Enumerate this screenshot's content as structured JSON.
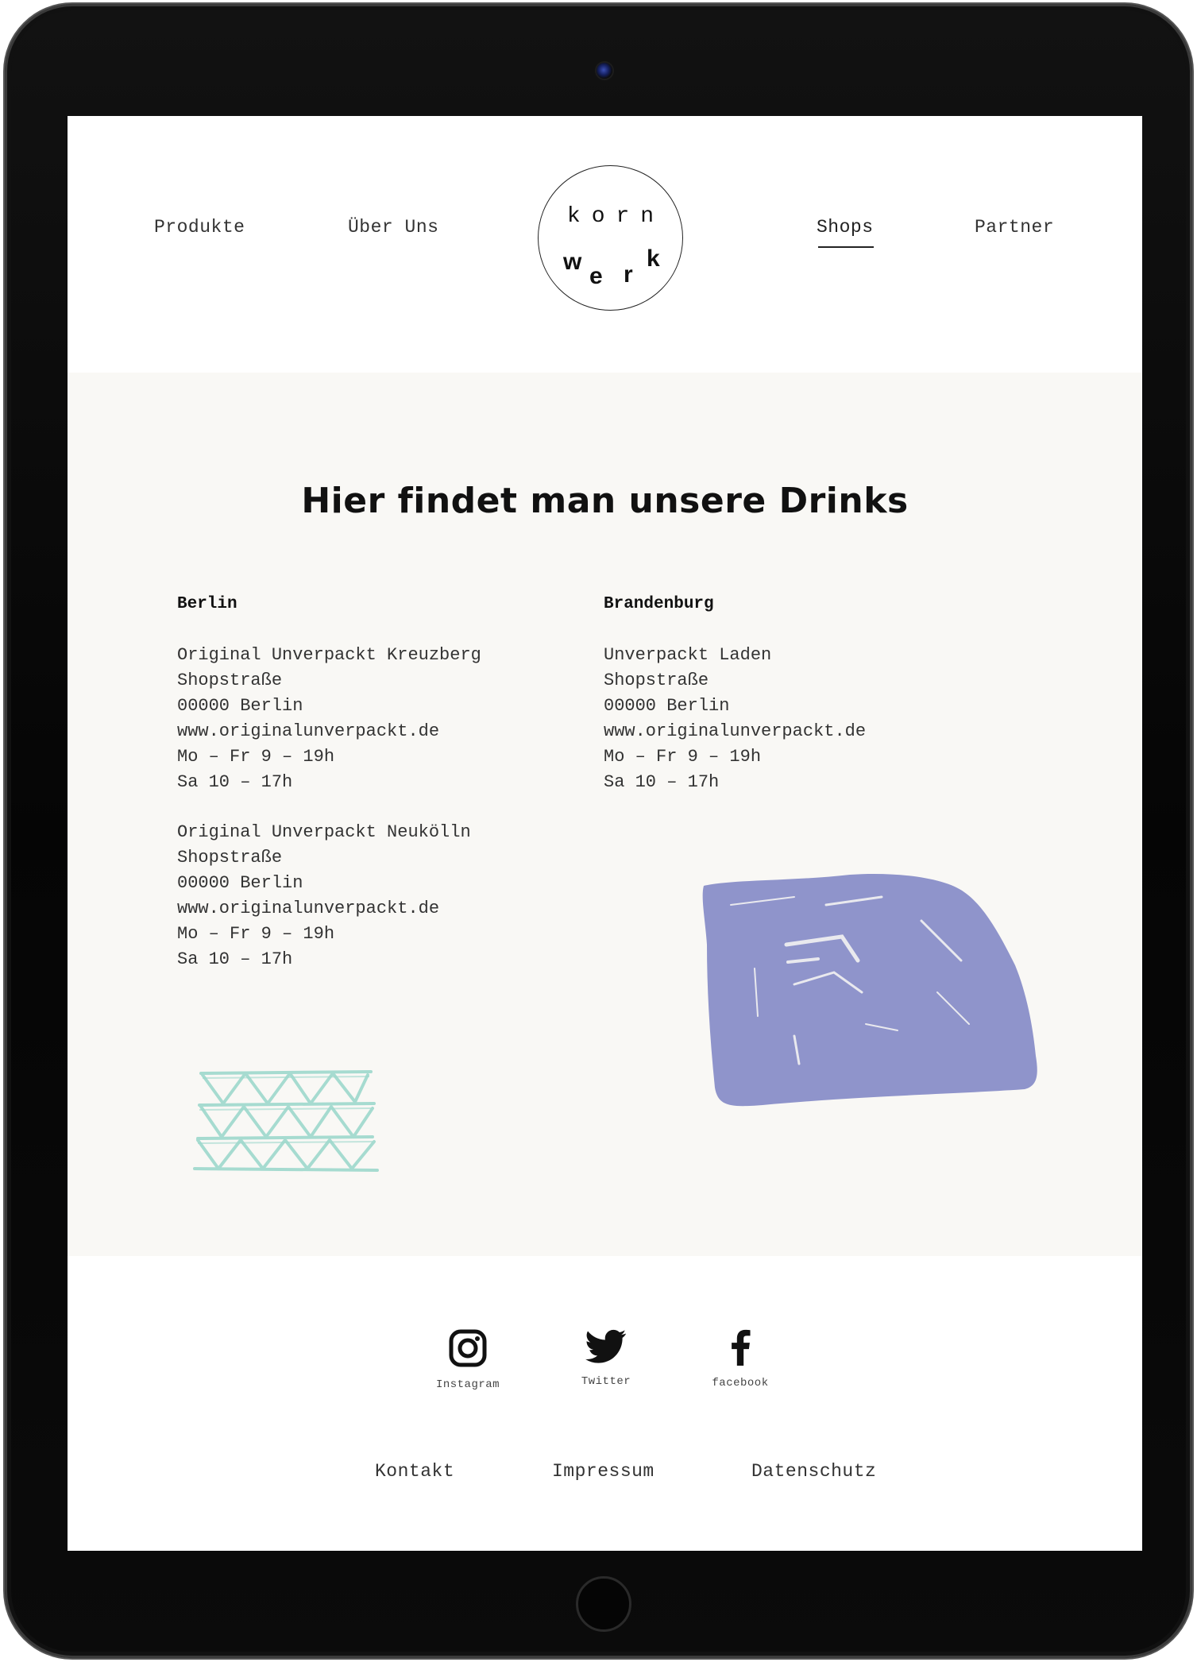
{
  "nav": {
    "left": [
      {
        "label": "Produkte"
      },
      {
        "label": "Über Uns"
      }
    ],
    "right": [
      {
        "label": "Shops",
        "active": true
      },
      {
        "label": "Partner"
      }
    ]
  },
  "logo": {
    "top": "korn",
    "bottom_letters": [
      "w",
      "e",
      "r",
      "k"
    ]
  },
  "main": {
    "title": "Hier findet man unsere Drinks",
    "regions": [
      {
        "name": "Berlin",
        "shops": [
          {
            "name": "Original Unverpackt Kreuzberg",
            "street": "Shopstraße",
            "city": "00000 Berlin",
            "web": "www.originalunverpackt.de",
            "hours_week": "Mo – Fr 9 – 19h",
            "hours_sat": "Sa 10 – 17h"
          },
          {
            "name": "Original Unverpackt Neukölln",
            "street": "Shopstraße",
            "city": "00000 Berlin",
            "web": "www.originalunverpackt.de",
            "hours_week": "Mo – Fr 9 – 19h",
            "hours_sat": "Sa 10 – 17h"
          }
        ]
      },
      {
        "name": "Brandenburg",
        "shops": [
          {
            "name": "Unverpackt Laden",
            "street": "Shopstraße",
            "city": "00000 Berlin",
            "web": "www.originalunverpackt.de",
            "hours_week": "Mo – Fr 9 – 19h",
            "hours_sat": "Sa 10 – 17h"
          }
        ]
      }
    ]
  },
  "footer": {
    "social": [
      {
        "label": "Instagram",
        "icon": "instagram-icon"
      },
      {
        "label": "Twitter",
        "icon": "twitter-icon"
      },
      {
        "label": "facebook",
        "icon": "facebook-icon"
      }
    ],
    "links": [
      {
        "label": "Kontakt"
      },
      {
        "label": "Impressum"
      },
      {
        "label": "Datenschutz"
      }
    ]
  },
  "colors": {
    "background_main": "#f9f8f5",
    "accent_lavender": "#8f94cb",
    "accent_mint": "#9ed8cc",
    "text": "#333333",
    "device_frame": "#0a0a0a"
  }
}
